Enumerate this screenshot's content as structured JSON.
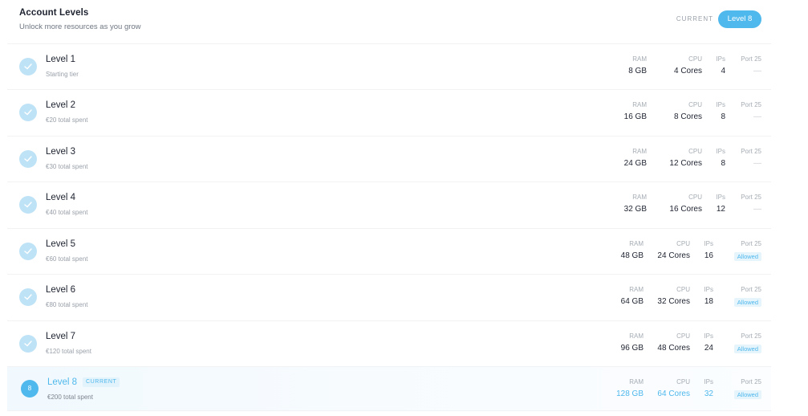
{
  "header": {
    "title": "Account Levels",
    "subtitle": "Unlock more resources as you grow",
    "current_label": "CURRENT",
    "current_level": "Level 8"
  },
  "columns": {
    "ram": "RAM",
    "cpu": "CPU",
    "ips": "IPs",
    "port": "Port 25"
  },
  "current_tag": "CURRENT",
  "levels": [
    {
      "name": "Level 1",
      "sub": "Starting tier",
      "ram": "8 GB",
      "cpu": "4 Cores",
      "ips": "4",
      "port": "—",
      "status": "done"
    },
    {
      "name": "Level 2",
      "sub": "€20 total spent",
      "ram": "16 GB",
      "cpu": "8 Cores",
      "ips": "8",
      "port": "—",
      "status": "done"
    },
    {
      "name": "Level 3",
      "sub": "€30 total spent",
      "ram": "24 GB",
      "cpu": "12 Cores",
      "ips": "8",
      "port": "—",
      "status": "done"
    },
    {
      "name": "Level 4",
      "sub": "€40 total spent",
      "ram": "32 GB",
      "cpu": "16 Cores",
      "ips": "12",
      "port": "—",
      "status": "done"
    },
    {
      "name": "Level 5",
      "sub": "€60 total spent",
      "ram": "48 GB",
      "cpu": "24 Cores",
      "ips": "16",
      "port": "Allowed",
      "status": "done"
    },
    {
      "name": "Level 6",
      "sub": "€80 total spent",
      "ram": "64 GB",
      "cpu": "32 Cores",
      "ips": "18",
      "port": "Allowed",
      "status": "done"
    },
    {
      "name": "Level 7",
      "sub": "€120 total spent",
      "ram": "96 GB",
      "cpu": "48 Cores",
      "ips": "24",
      "port": "Allowed",
      "status": "done"
    },
    {
      "name": "Level 8",
      "sub": "€200 total spent",
      "ram": "128 GB",
      "cpu": "64 Cores",
      "ips": "32",
      "port": "Allowed",
      "status": "current",
      "badge": "8"
    }
  ],
  "colors": {
    "accent": "#4fb8ec",
    "check_bg": "#bfe3f6",
    "allowed_bg": "#e6f4fc"
  },
  "icons": {
    "done": "checkmark-icon"
  }
}
